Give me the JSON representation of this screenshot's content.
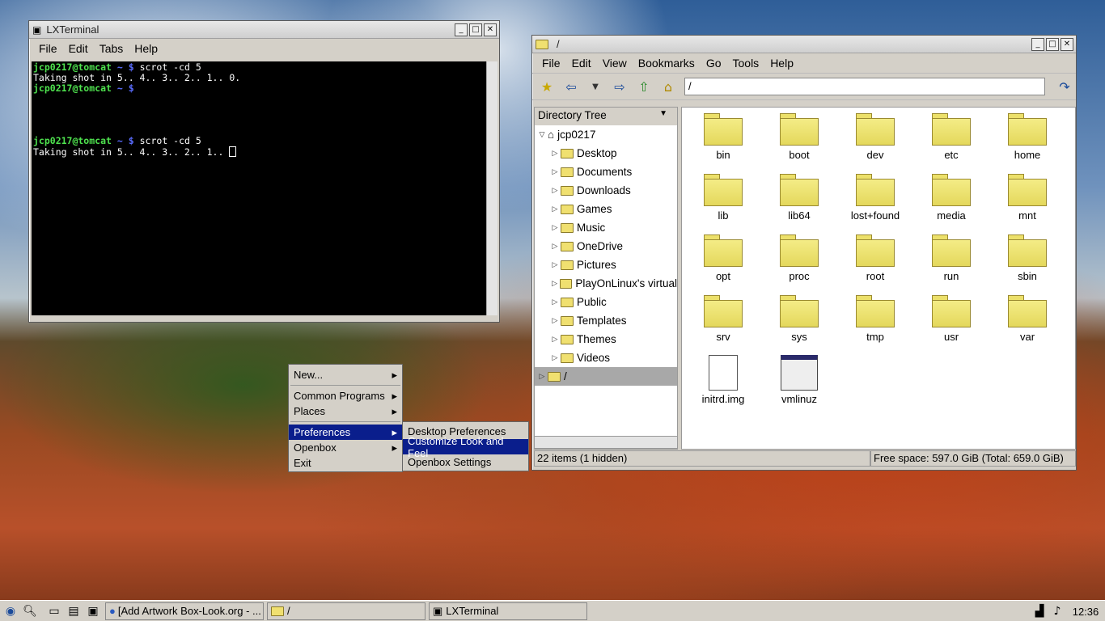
{
  "terminal": {
    "title": "LXTerminal",
    "menu": [
      "File",
      "Edit",
      "Tabs",
      "Help"
    ],
    "lines": [
      {
        "user": "jcp0217@tomcat",
        "path": "~",
        "prompt": "$",
        "cmd": "scrot -cd 5"
      },
      {
        "output": "Taking shot in 5.. 4.. 3.. 2.. 1.. 0."
      },
      {
        "user": "jcp0217@tomcat",
        "path": "~",
        "prompt": "$",
        "cmd": ""
      },
      {
        "user": "jcp0217@tomcat",
        "path": "~",
        "prompt": "$",
        "cmd": "scrot -cd 5"
      },
      {
        "output": "Taking shot in 5.. 4.. 3.. 2.. 1.. "
      }
    ]
  },
  "filemanager": {
    "title": "/",
    "menu": [
      "File",
      "Edit",
      "View",
      "Bookmarks",
      "Go",
      "Tools",
      "Help"
    ],
    "path": "/",
    "side_header": "Directory Tree",
    "tree_root": "jcp0217",
    "tree_items": [
      "Desktop",
      "Documents",
      "Downloads",
      "Games",
      "Music",
      "OneDrive",
      "Pictures",
      "PlayOnLinux's virtual",
      "Public",
      "Templates",
      "Themes",
      "Videos"
    ],
    "tree_last": "/",
    "folders": [
      "bin",
      "boot",
      "dev",
      "etc",
      "home",
      "lib",
      "lib64",
      "lost+found",
      "media",
      "mnt",
      "opt",
      "proc",
      "root",
      "run",
      "sbin",
      "srv",
      "sys",
      "tmp",
      "usr",
      "var"
    ],
    "files": [
      "initrd.img",
      "vmlinuz"
    ],
    "status_items": "22 items (1 hidden)",
    "status_space": "Free space: 597.0 GiB (Total: 659.0 GiB)"
  },
  "root_menu": {
    "items": [
      "New...",
      "Common Programs",
      "Places",
      "Preferences",
      "Openbox",
      "Exit"
    ]
  },
  "sub_menu": {
    "items": [
      "Desktop Preferences",
      "Customize Look and Feel",
      "Openbox Settings"
    ]
  },
  "taskbar": {
    "tasks": [
      "[Add  Artwork Box-Look.org - ...",
      "/",
      "LXTerminal"
    ],
    "clock": "12:36"
  }
}
